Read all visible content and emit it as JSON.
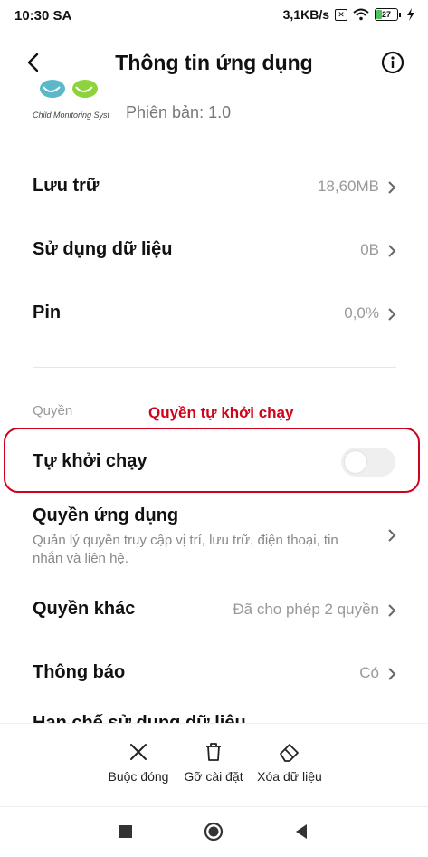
{
  "status_bar": {
    "time": "10:30 SA",
    "net_speed": "3,1KB/s",
    "battery": "27"
  },
  "header": {
    "title": "Thông tin ứng dụng"
  },
  "app": {
    "logo_caption": "Child Monitoring System",
    "version": "Phiên bản: 1.0"
  },
  "rows": {
    "storage": {
      "label": "Lưu trữ",
      "value": "18,60MB"
    },
    "data_usage": {
      "label": "Sử dụng dữ liệu",
      "value": "0B"
    },
    "battery": {
      "label": "Pin",
      "value": "0,0%"
    }
  },
  "permissions_section": {
    "label": "Quyền",
    "annotation": "Quyền tự khởi chạy",
    "autostart": {
      "label": "Tự khởi chạy",
      "enabled": false
    },
    "app_permissions": {
      "label": "Quyền ứng dụng",
      "description": "Quản lý quyền truy cập vị trí, lưu trữ, điện thoại, tin nhắn và liên hệ."
    },
    "other_permissions": {
      "label": "Quyền khác",
      "value": "Đã cho phép 2 quyền"
    },
    "notifications": {
      "label": "Thông báo",
      "value": "Có"
    },
    "clipped_row": {
      "label": "Hạn chế sử dụng dữ liệu"
    }
  },
  "bottom_actions": {
    "force_stop": "Buộc đóng",
    "uninstall": "Gỡ cài đặt",
    "clear_data": "Xóa dữ liệu"
  },
  "colors": {
    "accent_red": "#d0021b",
    "battery_green": "#4cc35b"
  }
}
